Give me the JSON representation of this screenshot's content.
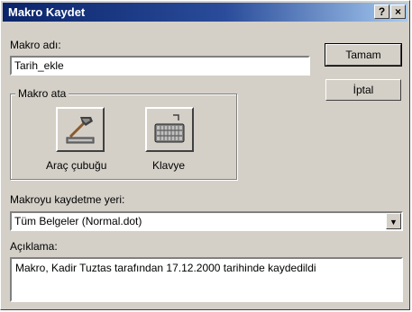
{
  "window": {
    "title": "Makro Kaydet",
    "help_button": "?",
    "close_button": "×"
  },
  "macro_name": {
    "label": "Makro adı:",
    "value": "Tarih_ekle"
  },
  "assign": {
    "group_label": "Makro ata",
    "toolbar_label": "Araç çubuğu",
    "keyboard_label": "Klavye"
  },
  "store": {
    "label": "Makroyu kaydetme yeri:",
    "selected": "Tüm Belgeler (Normal.dot)"
  },
  "description": {
    "label": "Açıklama:",
    "value": "Makro, Kadir Tuztas tarafından 17.12.2000 tarihinde kaydedildi"
  },
  "buttons": {
    "ok": "Tamam",
    "cancel": "İptal"
  },
  "icons": {
    "toolbar": "hammer-icon",
    "keyboard": "keyboard-icon",
    "dropdown": "triangle-down-icon"
  }
}
